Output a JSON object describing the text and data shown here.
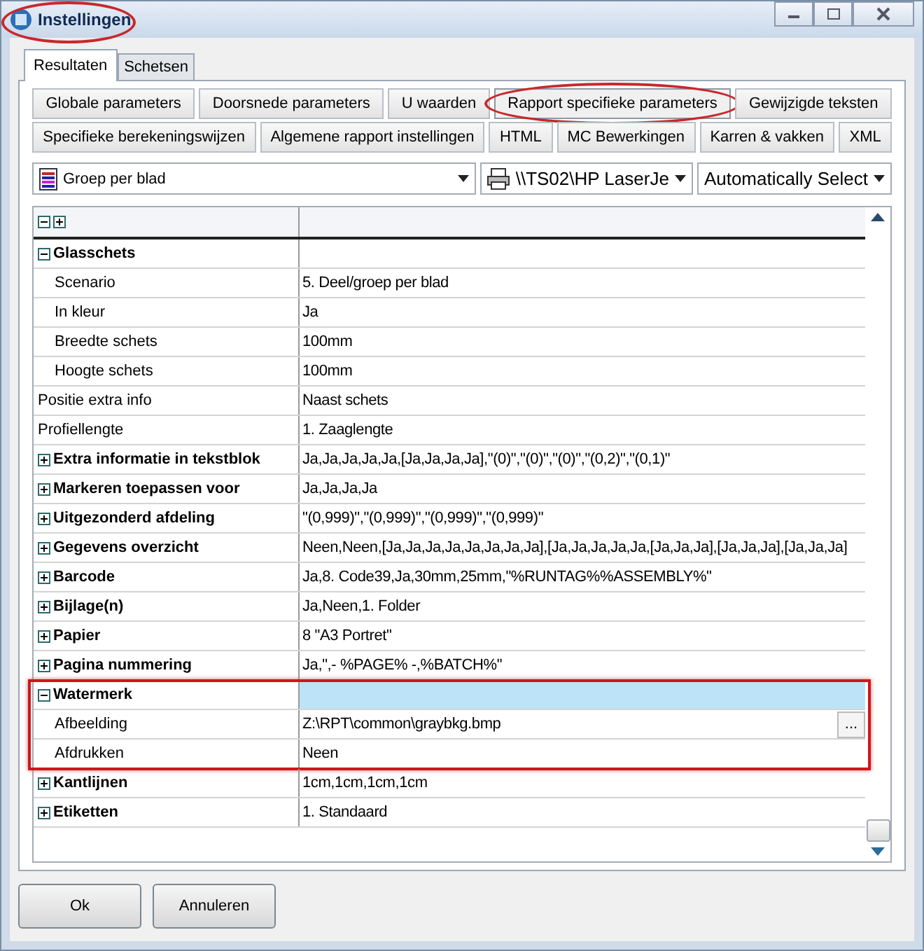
{
  "window": {
    "title": "Instellingen",
    "annotated": true
  },
  "tabs": [
    {
      "label": "Resultaten",
      "selected": true
    },
    {
      "label": "Schetsen",
      "selected": false
    }
  ],
  "section_buttons": [
    [
      {
        "label": "Globale parameters",
        "selected": false
      },
      {
        "label": "Doorsnede parameters",
        "selected": false
      },
      {
        "label": "U waarden",
        "selected": false
      },
      {
        "label": "Rapport specifieke parameters",
        "selected": true,
        "annotated": true
      },
      {
        "label": "Gewijzigde teksten",
        "selected": false
      }
    ],
    [
      {
        "label": "Specifieke berekeningswijzen",
        "selected": false
      },
      {
        "label": "Algemene rapport instellingen",
        "selected": false
      },
      {
        "label": "HTML",
        "selected": false
      },
      {
        "label": "MC Bewerkingen",
        "selected": false
      },
      {
        "label": "Karren & vakken",
        "selected": false
      },
      {
        "label": "XML",
        "selected": false
      }
    ]
  ],
  "dropdowns": [
    {
      "kind": "report",
      "value": "Groep per blad"
    },
    {
      "kind": "printer",
      "value": "\\\\TS02\\HP LaserJe"
    },
    {
      "kind": "plain",
      "value": "Automatically Select"
    }
  ],
  "properties": [
    {
      "kind": "group",
      "label": "Glasschets",
      "expanded": true,
      "selected": false,
      "children": [
        {
          "label": "Scenario",
          "value": "5. Deel/groep per blad",
          "selected": false
        },
        {
          "label": "In kleur",
          "value": "Ja",
          "selected": false
        },
        {
          "label": "Breedte schets",
          "value": "100mm",
          "selected": false
        },
        {
          "label": "Hoogte schets",
          "value": "100mm",
          "selected": false
        }
      ]
    },
    {
      "kind": "item",
      "label": "Positie extra info",
      "value": "Naast schets",
      "selected": false
    },
    {
      "kind": "item",
      "label": "Profiellengte",
      "value": "1. Zaaglengte",
      "selected": false
    },
    {
      "kind": "group",
      "label": "Extra informatie in tekstblok",
      "value": "Ja,Ja,Ja,Ja,Ja,[Ja,Ja,Ja,Ja],\"(0)\",\"(0)\",\"(0)\",\"(0,2)\",\"(0,1)\"",
      "expanded": false,
      "selected": false
    },
    {
      "kind": "group",
      "label": "Markeren toepassen voor",
      "value": "Ja,Ja,Ja,Ja",
      "expanded": false,
      "selected": false
    },
    {
      "kind": "group",
      "label": "Uitgezonderd afdeling",
      "value": "\"(0,999)\",\"(0,999)\",\"(0,999)\",\"(0,999)\"",
      "expanded": false,
      "selected": false
    },
    {
      "kind": "group",
      "label": "Gegevens overzicht",
      "value": "Neen,Neen,[Ja,Ja,Ja,Ja,Ja,Ja,Ja,Ja],[Ja,Ja,Ja,Ja,Ja,[Ja,Ja,Ja],[Ja,Ja,Ja],[Ja,Ja,Ja]",
      "expanded": false,
      "selected": false
    },
    {
      "kind": "group",
      "label": "Barcode",
      "value": "Ja,8. Code39,Ja,30mm,25mm,\"%RUNTAG%%ASSEMBLY%\"",
      "expanded": false,
      "selected": false
    },
    {
      "kind": "group",
      "label": "Bijlage(n)",
      "value": "Ja,Neen,1. Folder",
      "expanded": false,
      "selected": false
    },
    {
      "kind": "group",
      "label": "Papier",
      "value": "8 \"A3 Portret\"",
      "expanded": false,
      "selected": false
    },
    {
      "kind": "group",
      "label": "Pagina nummering",
      "value": "Ja,\",- %PAGE% -,%BATCH%\"",
      "expanded": false,
      "selected": false
    },
    {
      "kind": "group",
      "label": "Watermerk",
      "expanded": true,
      "selected": true,
      "annotated": true,
      "children": [
        {
          "label": "Afbeelding",
          "value": "Z:\\RPT\\common\\graybkg.bmp",
          "selected": false,
          "browse": "..."
        },
        {
          "label": "Afdrukken",
          "value": "Neen",
          "selected": false
        }
      ]
    },
    {
      "kind": "group",
      "label": "Kantlijnen",
      "value": "1cm,1cm,1cm,1cm",
      "expanded": false,
      "selected": false
    },
    {
      "kind": "group",
      "label": "Etiketten",
      "value": "1. Standaard",
      "expanded": false,
      "selected": false
    }
  ],
  "buttons": [
    {
      "label": "Ok"
    },
    {
      "label": "Annuleren"
    }
  ]
}
